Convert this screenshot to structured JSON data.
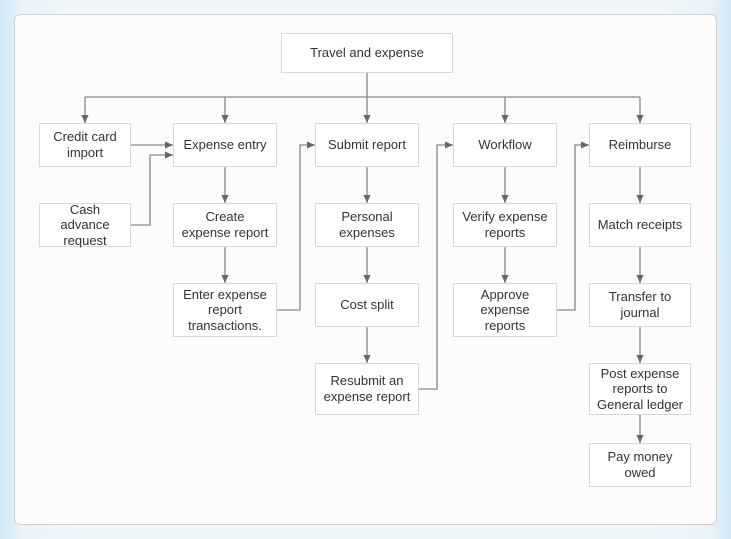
{
  "title": "Travel and expense",
  "col1": {
    "a": "Credit card import",
    "b": "Cash advance request"
  },
  "col2": {
    "a": "Expense entry",
    "b": "Create expense report",
    "c": "Enter expense report transactions."
  },
  "col3": {
    "a": "Submit report",
    "b": "Personal expenses",
    "c": "Cost split",
    "d": "Resubmit an expense report"
  },
  "col4": {
    "a": "Workflow",
    "b": "Verify expense reports",
    "c": "Approve expense reports"
  },
  "col5": {
    "a": "Reimburse",
    "b": "Match receipts",
    "c": "Transfer to journal",
    "d": "Post expense reports to General ledger",
    "e": "Pay money owed"
  }
}
